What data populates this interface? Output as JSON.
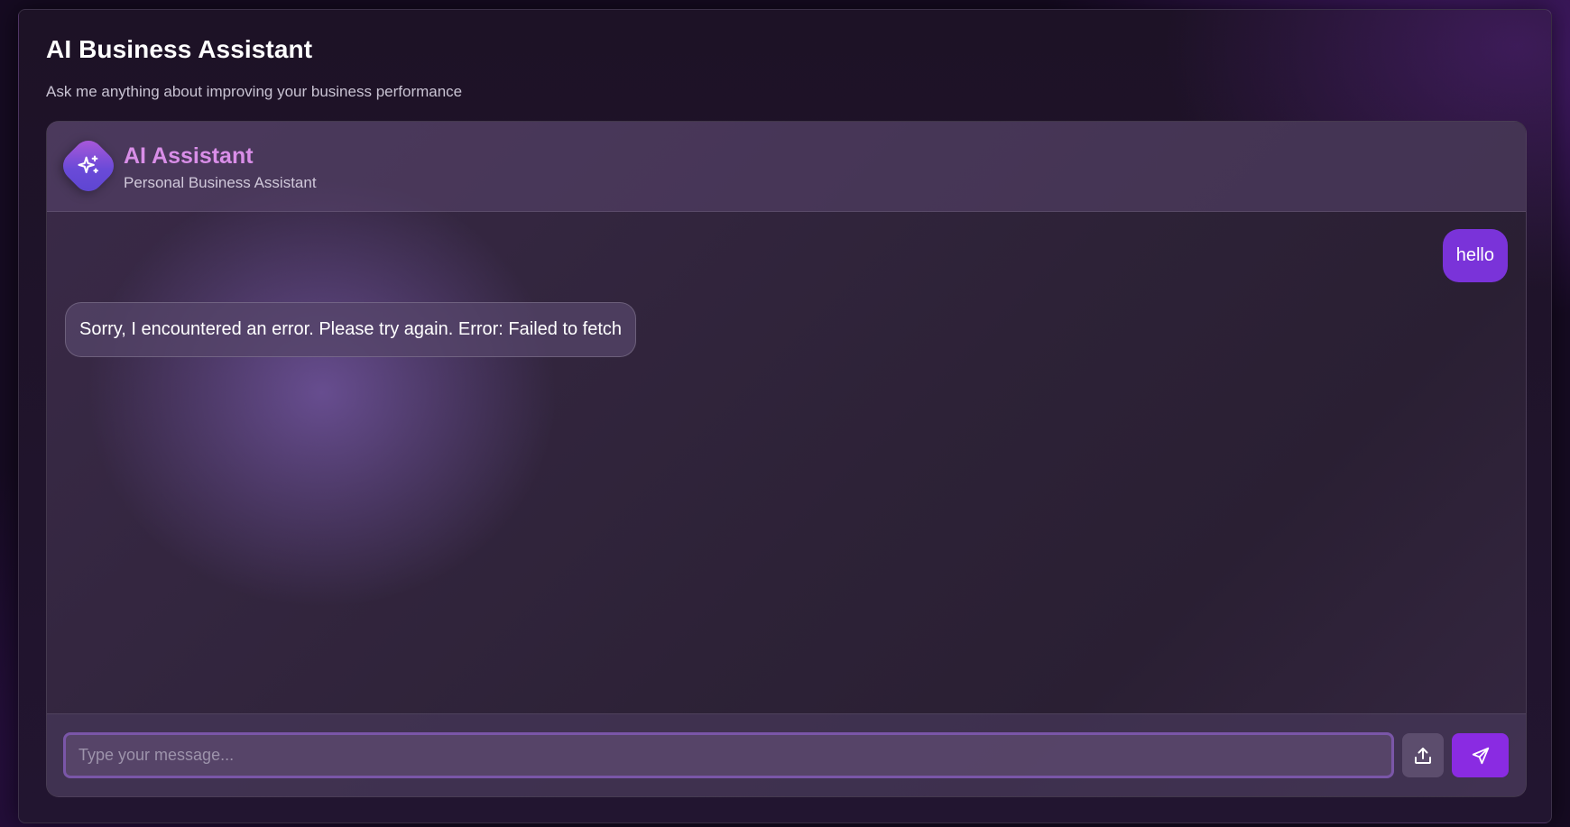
{
  "page": {
    "title": "AI Business Assistant",
    "subtitle": "Ask me anything about improving your business performance"
  },
  "assistant": {
    "name": "AI Assistant",
    "role": "Personal Business Assistant",
    "avatar_icon": "sparkles-icon"
  },
  "messages": [
    {
      "sender": "user",
      "text": "hello"
    },
    {
      "sender": "assistant",
      "text": "Sorry, I encountered an error. Please try again. Error: Failed to fetch"
    }
  ],
  "composer": {
    "placeholder": "Type your message...",
    "value": "",
    "upload_icon": "upload-icon",
    "send_icon": "send-icon"
  },
  "colors": {
    "accent": "#8a2be2",
    "user_bubble": "#7a33d9",
    "assistant_name": "#d98ee8",
    "background": "#160b22"
  }
}
